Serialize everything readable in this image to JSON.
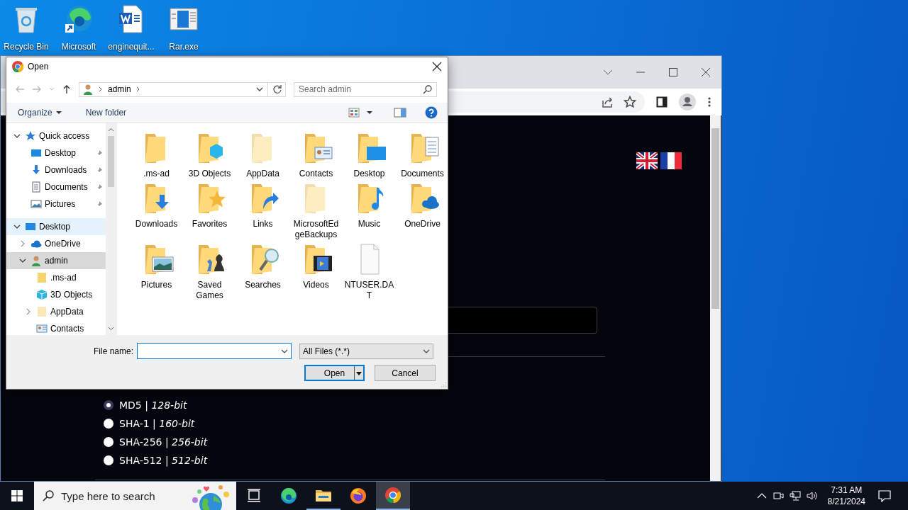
{
  "desktop_icons": [
    {
      "label": "Recycle Bin",
      "kind": "recycle"
    },
    {
      "label": "Microsoft",
      "kind": "edge"
    },
    {
      "label": "enginequit...",
      "kind": "word"
    },
    {
      "label": "Rar.exe",
      "kind": "app"
    }
  ],
  "browser": {
    "hash_options": [
      {
        "text": "MD5 | *128-bit*",
        "selected": true
      },
      {
        "text": "SHA-1 | *160-bit*",
        "selected": false
      },
      {
        "text": "SHA-256 | *256-bit*",
        "selected": false
      },
      {
        "text": "SHA-512 | *512-bit*",
        "selected": false
      }
    ]
  },
  "dialog": {
    "title": "Open",
    "path": [
      "admin"
    ],
    "search": {
      "placeholder": "Search admin"
    },
    "toolbar": [
      "Organize",
      "New folder"
    ],
    "nav": [
      {
        "label": "Quick access",
        "kind": "star",
        "expanded": true,
        "selected": false,
        "hovered": false,
        "pinned": false,
        "children": [
          {
            "label": "Desktop",
            "kind": "desktop",
            "selected": false,
            "hovered": false,
            "pinned": true
          },
          {
            "label": "Downloads",
            "kind": "downloads",
            "selected": false,
            "hovered": false,
            "pinned": true
          },
          {
            "label": "Documents",
            "kind": "documents",
            "selected": false,
            "hovered": false,
            "pinned": true
          },
          {
            "label": "Pictures",
            "kind": "pictures",
            "selected": false,
            "hovered": false,
            "pinned": true
          }
        ]
      },
      {
        "label": "Desktop",
        "kind": "desktop",
        "expanded": true,
        "selected": false,
        "hovered": true,
        "pinned": false,
        "children": [
          {
            "label": "OneDrive",
            "kind": "onedrive",
            "expanded": false,
            "selected": false,
            "hovered": false,
            "pinned": false
          },
          {
            "label": "admin",
            "kind": "user",
            "expanded": true,
            "selected": true,
            "hovered": false,
            "pinned": false,
            "children": [
              {
                "label": ".ms-ad",
                "kind": "folder",
                "selected": false,
                "hovered": false,
                "pinned": false
              },
              {
                "label": "3D Objects",
                "kind": "cube",
                "selected": false,
                "hovered": false,
                "pinned": false
              },
              {
                "label": "AppData",
                "kind": "folder",
                "expanded": false,
                "selected": false,
                "hovered": false,
                "pinned": false
              },
              {
                "label": "Contacts",
                "kind": "contacts",
                "selected": false,
                "hovered": false,
                "pinned": false
              }
            ]
          }
        ]
      }
    ],
    "files": [
      {
        "name": ".ms-ad",
        "kind": "folder",
        "hidden": false
      },
      {
        "name": "3D Objects",
        "kind": "cube",
        "hidden": false
      },
      {
        "name": "AppData",
        "kind": "folder",
        "hidden": true
      },
      {
        "name": "Contacts",
        "kind": "contacts",
        "hidden": false
      },
      {
        "name": "Desktop",
        "kind": "desktop",
        "hidden": false
      },
      {
        "name": "Documents",
        "kind": "documents",
        "hidden": false
      },
      {
        "name": "Downloads",
        "kind": "downloads",
        "hidden": false
      },
      {
        "name": "Favorites",
        "kind": "favorites",
        "hidden": false
      },
      {
        "name": "Links",
        "kind": "links",
        "hidden": false
      },
      {
        "name": "MicrosoftEdgeBackups",
        "kind": "folder",
        "hidden": true
      },
      {
        "name": "Music",
        "kind": "music",
        "hidden": false
      },
      {
        "name": "OneDrive",
        "kind": "onedrive",
        "hidden": false
      },
      {
        "name": "Pictures",
        "kind": "pictures",
        "hidden": false
      },
      {
        "name": "Saved Games",
        "kind": "games",
        "hidden": false
      },
      {
        "name": "Searches",
        "kind": "searches",
        "hidden": false
      },
      {
        "name": "Videos",
        "kind": "videos",
        "hidden": false
      },
      {
        "name": "NTUSER.DAT",
        "kind": "file",
        "hidden": false
      }
    ],
    "file_name_label": "File name:",
    "filter": "All Files (*.*)",
    "buttons": [
      "Open",
      "Cancel"
    ]
  },
  "taskbar": {
    "search": {
      "placeholder": "Type here to search"
    },
    "apps": [
      {
        "kind": "taskview",
        "active": false,
        "running": false
      },
      {
        "kind": "edge",
        "active": false,
        "running": false
      },
      {
        "kind": "explorer",
        "active": false,
        "running": true
      },
      {
        "kind": "firefox",
        "active": false,
        "running": false
      },
      {
        "kind": "chrome",
        "active": true,
        "running": true
      }
    ],
    "clock": {
      "time": "7:31 AM",
      "date": "8/21/2024"
    }
  }
}
